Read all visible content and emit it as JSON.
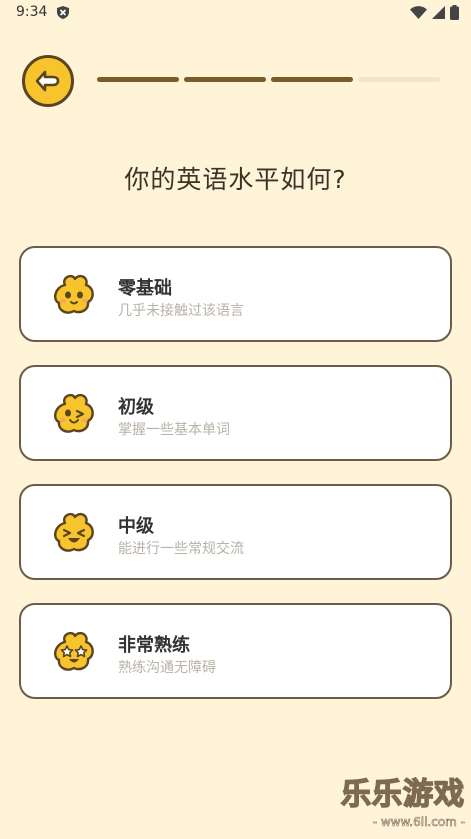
{
  "status_bar": {
    "time": "9:34"
  },
  "header": {
    "progress": {
      "completed": 3,
      "total": 4
    }
  },
  "question": "你的英语水平如何?",
  "options": [
    {
      "title": "零基础",
      "subtitle": "几乎未接触过该语言",
      "face": "neutral-face-icon"
    },
    {
      "title": "初级",
      "subtitle": "掌握一些基本单词",
      "face": "wink-face-icon"
    },
    {
      "title": "中级",
      "subtitle": "能进行一些常规交流",
      "face": "happy-face-icon"
    },
    {
      "title": "非常熟练",
      "subtitle": "熟练沟通无障碍",
      "face": "star-eyes-face-icon"
    }
  ],
  "watermark": {
    "main": "乐乐游戏",
    "url": "- www.6ll.com -"
  },
  "colors": {
    "background": "#fff4d8",
    "accent": "#f7c42d",
    "border": "#6b5d47",
    "progress_done": "#7a5c2a"
  }
}
